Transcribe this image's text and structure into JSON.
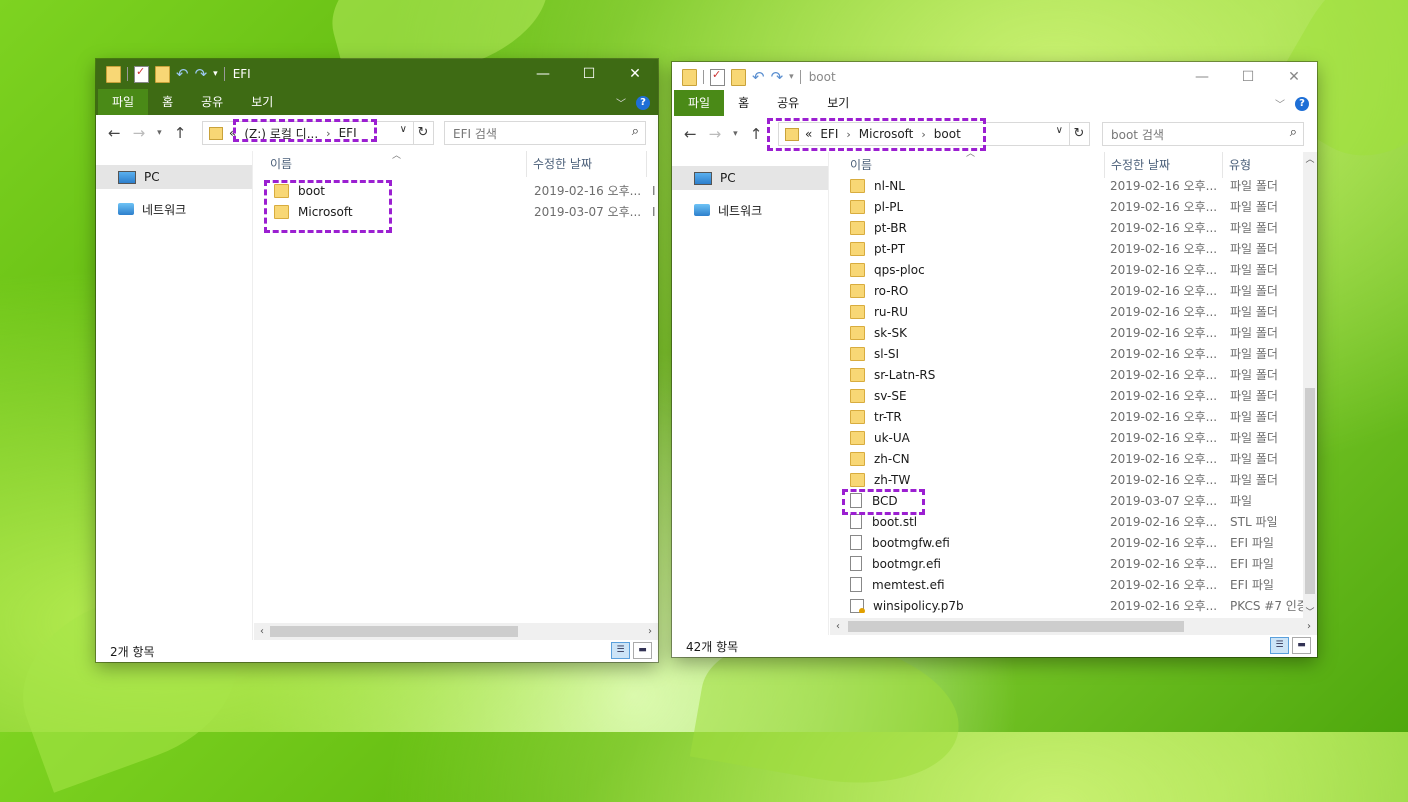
{
  "desktop": {
    "background": "green leaves wallpaper"
  },
  "left_window": {
    "title": "EFI",
    "tabs": [
      "파일",
      "홈",
      "공유",
      "보기"
    ],
    "address": {
      "overflow": "«",
      "segments": [
        "(Z:) 로컬 디...",
        "EFI"
      ]
    },
    "search_placeholder": "EFI 검색",
    "nav": {
      "pc": "PC",
      "network": "네트워크"
    },
    "columns": {
      "name": "이름",
      "modified": "수정한 날짜"
    },
    "rows": [
      {
        "name": "boot",
        "date": "2019-02-16 오후...",
        "extra": "I"
      },
      {
        "name": "Microsoft",
        "date": "2019-03-07 오후...",
        "extra": "I"
      }
    ],
    "status": "2개 항목"
  },
  "right_window": {
    "title": "boot",
    "tabs": [
      "파일",
      "홈",
      "공유",
      "보기"
    ],
    "address": {
      "overflow": "«",
      "segments": [
        "EFI",
        "Microsoft",
        "boot"
      ]
    },
    "search_placeholder": "boot 검색",
    "nav": {
      "pc": "PC",
      "network": "네트워크"
    },
    "columns": {
      "name": "이름",
      "modified": "수정한 날짜",
      "type": "유형"
    },
    "rows": [
      {
        "name": "nl-NL",
        "date": "2019-02-16 오후...",
        "type": "파일 폴더",
        "icon": "folder"
      },
      {
        "name": "pl-PL",
        "date": "2019-02-16 오후...",
        "type": "파일 폴더",
        "icon": "folder"
      },
      {
        "name": "pt-BR",
        "date": "2019-02-16 오후...",
        "type": "파일 폴더",
        "icon": "folder"
      },
      {
        "name": "pt-PT",
        "date": "2019-02-16 오후...",
        "type": "파일 폴더",
        "icon": "folder"
      },
      {
        "name": "qps-ploc",
        "date": "2019-02-16 오후...",
        "type": "파일 폴더",
        "icon": "folder"
      },
      {
        "name": "ro-RO",
        "date": "2019-02-16 오후...",
        "type": "파일 폴더",
        "icon": "folder"
      },
      {
        "name": "ru-RU",
        "date": "2019-02-16 오후...",
        "type": "파일 폴더",
        "icon": "folder"
      },
      {
        "name": "sk-SK",
        "date": "2019-02-16 오후...",
        "type": "파일 폴더",
        "icon": "folder"
      },
      {
        "name": "sl-SI",
        "date": "2019-02-16 오후...",
        "type": "파일 폴더",
        "icon": "folder"
      },
      {
        "name": "sr-Latn-RS",
        "date": "2019-02-16 오후...",
        "type": "파일 폴더",
        "icon": "folder"
      },
      {
        "name": "sv-SE",
        "date": "2019-02-16 오후...",
        "type": "파일 폴더",
        "icon": "folder"
      },
      {
        "name": "tr-TR",
        "date": "2019-02-16 오후...",
        "type": "파일 폴더",
        "icon": "folder"
      },
      {
        "name": "uk-UA",
        "date": "2019-02-16 오후...",
        "type": "파일 폴더",
        "icon": "folder"
      },
      {
        "name": "zh-CN",
        "date": "2019-02-16 오후...",
        "type": "파일 폴더",
        "icon": "folder"
      },
      {
        "name": "zh-TW",
        "date": "2019-02-16 오후...",
        "type": "파일 폴더",
        "icon": "folder"
      },
      {
        "name": "BCD",
        "date": "2019-03-07 오후...",
        "type": "파일",
        "icon": "file"
      },
      {
        "name": "boot.stl",
        "date": "2019-02-16 오후...",
        "type": "STL 파일",
        "icon": "file"
      },
      {
        "name": "bootmgfw.efi",
        "date": "2019-02-16 오후...",
        "type": "EFI 파일",
        "icon": "file"
      },
      {
        "name": "bootmgr.efi",
        "date": "2019-02-16 오후...",
        "type": "EFI 파일",
        "icon": "file"
      },
      {
        "name": "memtest.efi",
        "date": "2019-02-16 오후...",
        "type": "EFI 파일",
        "icon": "file"
      },
      {
        "name": "winsipolicy.p7b",
        "date": "2019-02-16 오후...",
        "type": "PKCS #7 인증",
        "icon": "cert"
      }
    ],
    "status": "42개 항목"
  },
  "highlight_color": "#9b1fd1",
  "ribbon_color_left": "#3e6b14",
  "file_tab_color": "#4a8a17"
}
